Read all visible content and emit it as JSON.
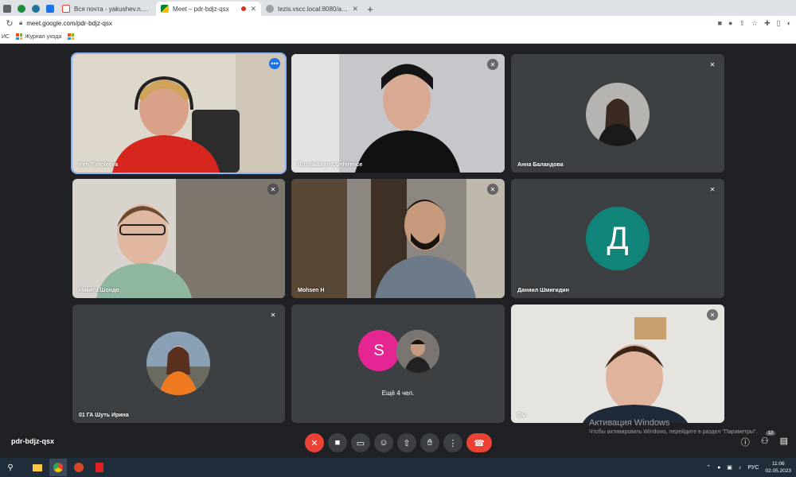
{
  "browser": {
    "tabs": [
      {
        "title": "",
        "icon": "cube-icon",
        "small": true
      },
      {
        "title": "",
        "icon": "green-circle-icon",
        "small": true
      },
      {
        "title": "",
        "icon": "wordpress-icon",
        "small": true
      },
      {
        "title": "",
        "icon": "document-icon",
        "small": true
      },
      {
        "title": "Вся почта - yakushev.n.o@gmail",
        "icon": "gmail-icon"
      },
      {
        "title": "Meet – pdr-bdjz-qsx",
        "icon": "meet-icon",
        "active": true
      },
      {
        "title": "tezis.vscc.local:8080/app",
        "icon": "globe-icon"
      }
    ],
    "address": "meet.google.com/pdr-bdjz-qsx",
    "bookmarks": [
      "ИС",
      "Журнал ухода"
    ]
  },
  "meeting": {
    "code": "pdr-bdjz-qsx",
    "participants": [
      {
        "name": "Iren Timofeeva",
        "type": "video",
        "active": true
      },
      {
        "name": "Russia&Iran Conference",
        "type": "video",
        "muted": true
      },
      {
        "name": "Анна Баландова",
        "type": "photo",
        "muted": true
      },
      {
        "name": "Никита Шондо",
        "type": "video",
        "muted": true
      },
      {
        "name": "Mohsen H",
        "type": "video",
        "muted": true
      },
      {
        "name": "Даниил Шмигидин",
        "type": "letter",
        "letter": "Д",
        "muted": true
      },
      {
        "name": "01 ГА Шуть Ирина",
        "type": "photo",
        "muted": true
      },
      {
        "name": "",
        "type": "more",
        "more_text": "Ещё 4 чел.",
        "letter": "S"
      },
      {
        "name": "Вы",
        "type": "video",
        "muted": true
      }
    ],
    "participants_count": "12"
  },
  "watermark": {
    "line1": "Активация Windows",
    "line2": "Чтобы активировать Windows, перейдите в раздел \"Параметры\"."
  },
  "taskbar": {
    "lang": "РУС",
    "time": "11:06",
    "date": "02.05.2023"
  },
  "colors": {
    "meet_bg": "#202124",
    "tile_bg": "#3c4043",
    "accent": "#1a73e8",
    "hangup": "#ea4335",
    "avatar_d": "#12857a",
    "avatar_s": "#e52592"
  }
}
